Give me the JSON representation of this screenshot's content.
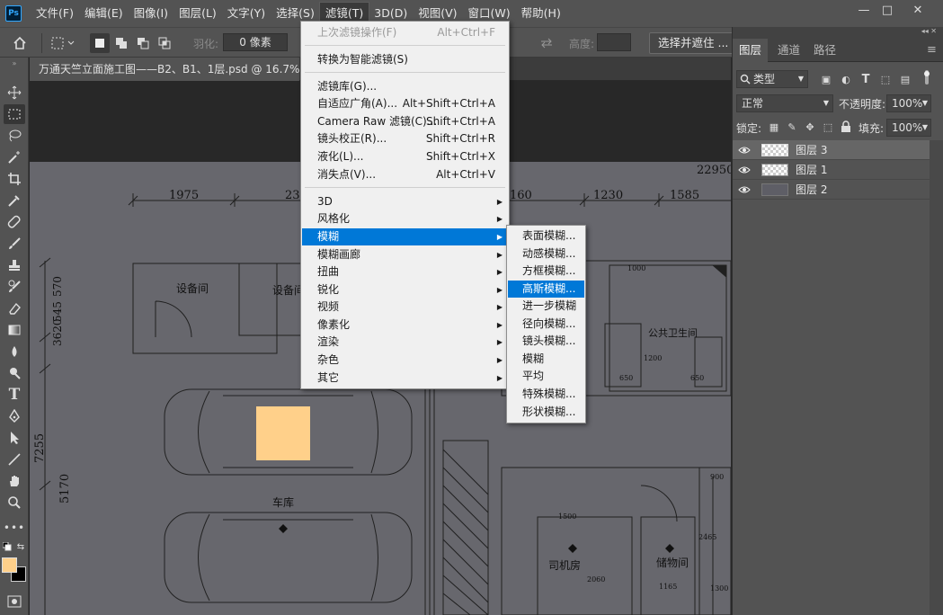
{
  "app": {
    "logo": "Ps"
  },
  "menubar": {
    "items": [
      "文件(F)",
      "编辑(E)",
      "图像(I)",
      "图层(L)",
      "文字(Y)",
      "选择(S)",
      "滤镜(T)",
      "3D(D)",
      "视图(V)",
      "窗口(W)",
      "帮助(H)"
    ],
    "active_index": 6
  },
  "window_controls": {
    "minimize": "—",
    "maximize": "□",
    "close": "✕"
  },
  "options_bar": {
    "feather_label": "羽化:",
    "feather_value": "0 像素",
    "height_label": "高度:",
    "select_mask_button": "选择并遮住 ..."
  },
  "document": {
    "tab_title": "万通天竺立面施工图——B2、B1、1层.psd @ 16.7% (图层 3, RGB/8)"
  },
  "canvas": {
    "dimensions": [
      "1975",
      "23",
      "160",
      "1230",
      "1585",
      "22950"
    ],
    "vertical_dimensions": [
      "3620",
      "545",
      "570",
      "7255",
      "5170"
    ],
    "room_labels": [
      "设备间",
      "设备间",
      "公共卫生间",
      "车库",
      "司机房",
      "储物间"
    ],
    "small_numbers": [
      "1000",
      "1200",
      "650",
      "650",
      "1500",
      "2060",
      "1165",
      "2465",
      "900",
      "1300"
    ],
    "fill_swatch_color": "#ffd08a"
  },
  "filter_menu": {
    "items": [
      {
        "label": "上次滤镜操作(F)",
        "shortcut": "Alt+Ctrl+F",
        "disabled": true
      },
      {
        "label": "转换为智能滤镜(S)",
        "shortcut": ""
      },
      {
        "label": "滤镜库(G)...",
        "shortcut": ""
      },
      {
        "label": "自适应广角(A)...",
        "shortcut": "Alt+Shift+Ctrl+A"
      },
      {
        "label": "Camera Raw 滤镜(C)...",
        "shortcut": "Shift+Ctrl+A"
      },
      {
        "label": "镜头校正(R)...",
        "shortcut": "Shift+Ctrl+R"
      },
      {
        "label": "液化(L)...",
        "shortcut": "Shift+Ctrl+X"
      },
      {
        "label": "消失点(V)...",
        "shortcut": "Alt+Ctrl+V"
      },
      {
        "label": "3D",
        "submenu": true
      },
      {
        "label": "风格化",
        "submenu": true
      },
      {
        "label": "模糊",
        "submenu": true,
        "highlighted": true
      },
      {
        "label": "模糊画廊",
        "submenu": true
      },
      {
        "label": "扭曲",
        "submenu": true
      },
      {
        "label": "锐化",
        "submenu": true
      },
      {
        "label": "视频",
        "submenu": true
      },
      {
        "label": "像素化",
        "submenu": true
      },
      {
        "label": "渲染",
        "submenu": true
      },
      {
        "label": "杂色",
        "submenu": true
      },
      {
        "label": "其它",
        "submenu": true
      }
    ]
  },
  "blur_submenu": {
    "items": [
      "表面模糊...",
      "动感模糊...",
      "方框模糊...",
      "高斯模糊...",
      "进一步模糊",
      "径向模糊...",
      "镜头模糊...",
      "模糊",
      "平均",
      "特殊模糊...",
      "形状模糊..."
    ],
    "highlighted_index": 3
  },
  "layers_panel": {
    "tabs": [
      "图层",
      "通道",
      "路径"
    ],
    "active_tab": 0,
    "filter_kind": "类型",
    "blend_mode": "正常",
    "opacity_label": "不透明度:",
    "opacity_value": "100%",
    "lock_label": "锁定:",
    "fill_label": "填充:",
    "fill_value": "100%",
    "layers": [
      {
        "name": "图层 3",
        "selected": true,
        "thumb": "trans"
      },
      {
        "name": "图层 1",
        "selected": false,
        "thumb": "trans"
      },
      {
        "name": "图层 2",
        "selected": false,
        "thumb": "dark"
      }
    ]
  },
  "colors": {
    "foreground": "#ffd08a",
    "background": "#000000",
    "highlight": "#0078d7",
    "ps_blue": "#31a8ff"
  }
}
